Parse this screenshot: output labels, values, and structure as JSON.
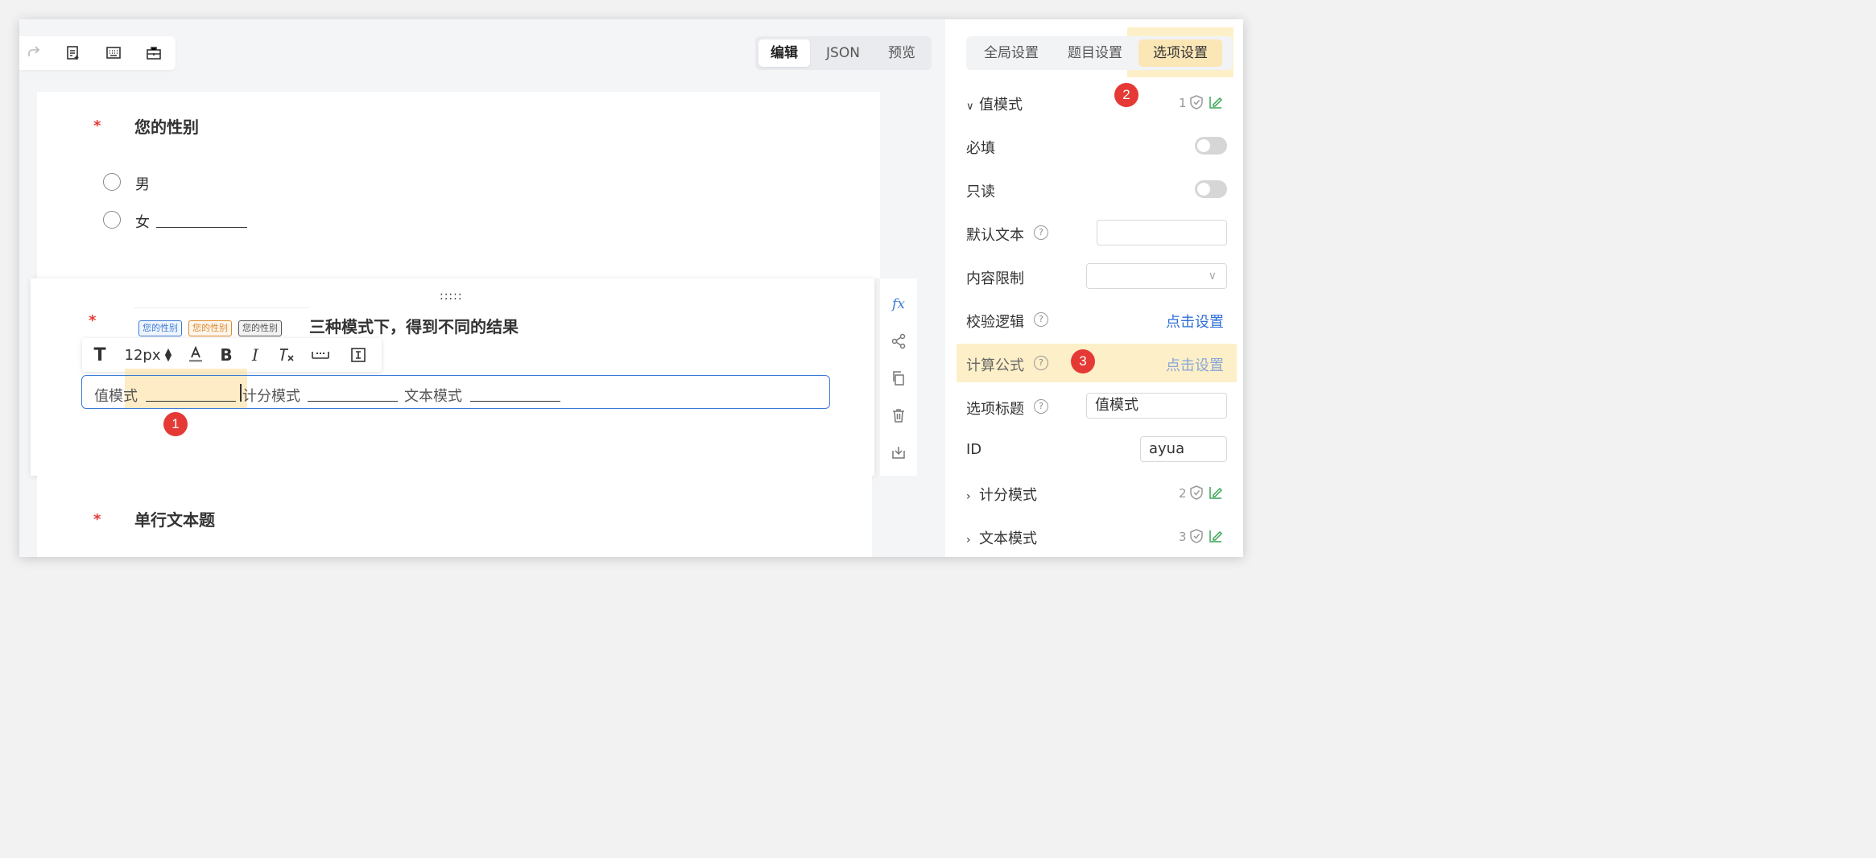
{
  "toolbar": {
    "icons": [
      "redo-icon",
      "form-icon",
      "keyboard-icon",
      "briefcase-icon"
    ]
  },
  "view_switch": {
    "edit": "编辑",
    "json": "JSON",
    "preview": "预览"
  },
  "q1": {
    "title": "您的性别",
    "options": [
      "男",
      "女"
    ]
  },
  "q2": {
    "title_tail": "三种模式下，得到不同的结果",
    "tags": [
      {
        "label": "您的性别",
        "color": "#3b7bd8"
      },
      {
        "label": "您的性别",
        "color": "#e08a2a"
      },
      {
        "label": "您的性别",
        "color": "#555555"
      }
    ],
    "font_size": "12px",
    "segments": [
      "值模式",
      "计分模式",
      "文本模式"
    ],
    "drag": ":::::"
  },
  "q3": {
    "title": "单行文本题"
  },
  "side_tools": [
    "fx-icon",
    "logic-icon",
    "copy-icon",
    "delete-icon",
    "save-icon"
  ],
  "panel": {
    "tabs": [
      "全局设置",
      "题目设置",
      "选项设置"
    ],
    "value_mode": {
      "label": "值模式",
      "count": "1"
    },
    "required": "必填",
    "readonly": "只读",
    "default_text": "默认文本",
    "content_limit": "内容限制",
    "validate": {
      "label": "校验逻辑",
      "link": "点击设置"
    },
    "formula": {
      "label": "计算公式",
      "link": "点击设置"
    },
    "option_title": {
      "label": "选项标题",
      "value": "值模式"
    },
    "id": {
      "label": "ID",
      "value": "ayua"
    },
    "score_mode": {
      "label": "计分模式",
      "count": "2"
    },
    "text_mode": {
      "label": "文本模式",
      "count": "3"
    }
  },
  "badges": [
    "1",
    "2",
    "3"
  ],
  "colors": {
    "accent": "#3b7bd8",
    "badge": "#e53935",
    "highlight": "#fdf0c8",
    "success": "#3aa655"
  }
}
